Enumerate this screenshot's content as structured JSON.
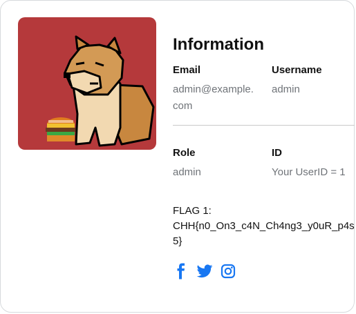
{
  "profile": {
    "title": "Information",
    "email_label": "Email",
    "email_value": "admin@example.com",
    "username_label": "Username",
    "username_value": "admin",
    "role_label": "Role",
    "role_value": "admin",
    "id_label": "ID",
    "id_value": "Your UserID = 1",
    "flag_label": "FLAG 1:",
    "flag_value": "CHH{n0_On3_c4N_Ch4ng3_y0uR_p4s5}"
  },
  "social": [
    "facebook-icon",
    "twitter-icon",
    "instagram-icon"
  ],
  "colors": {
    "avatar_bg": "#b5393b",
    "social_blue": "#1877f2",
    "label": "#111111",
    "value": "#6f7378"
  }
}
